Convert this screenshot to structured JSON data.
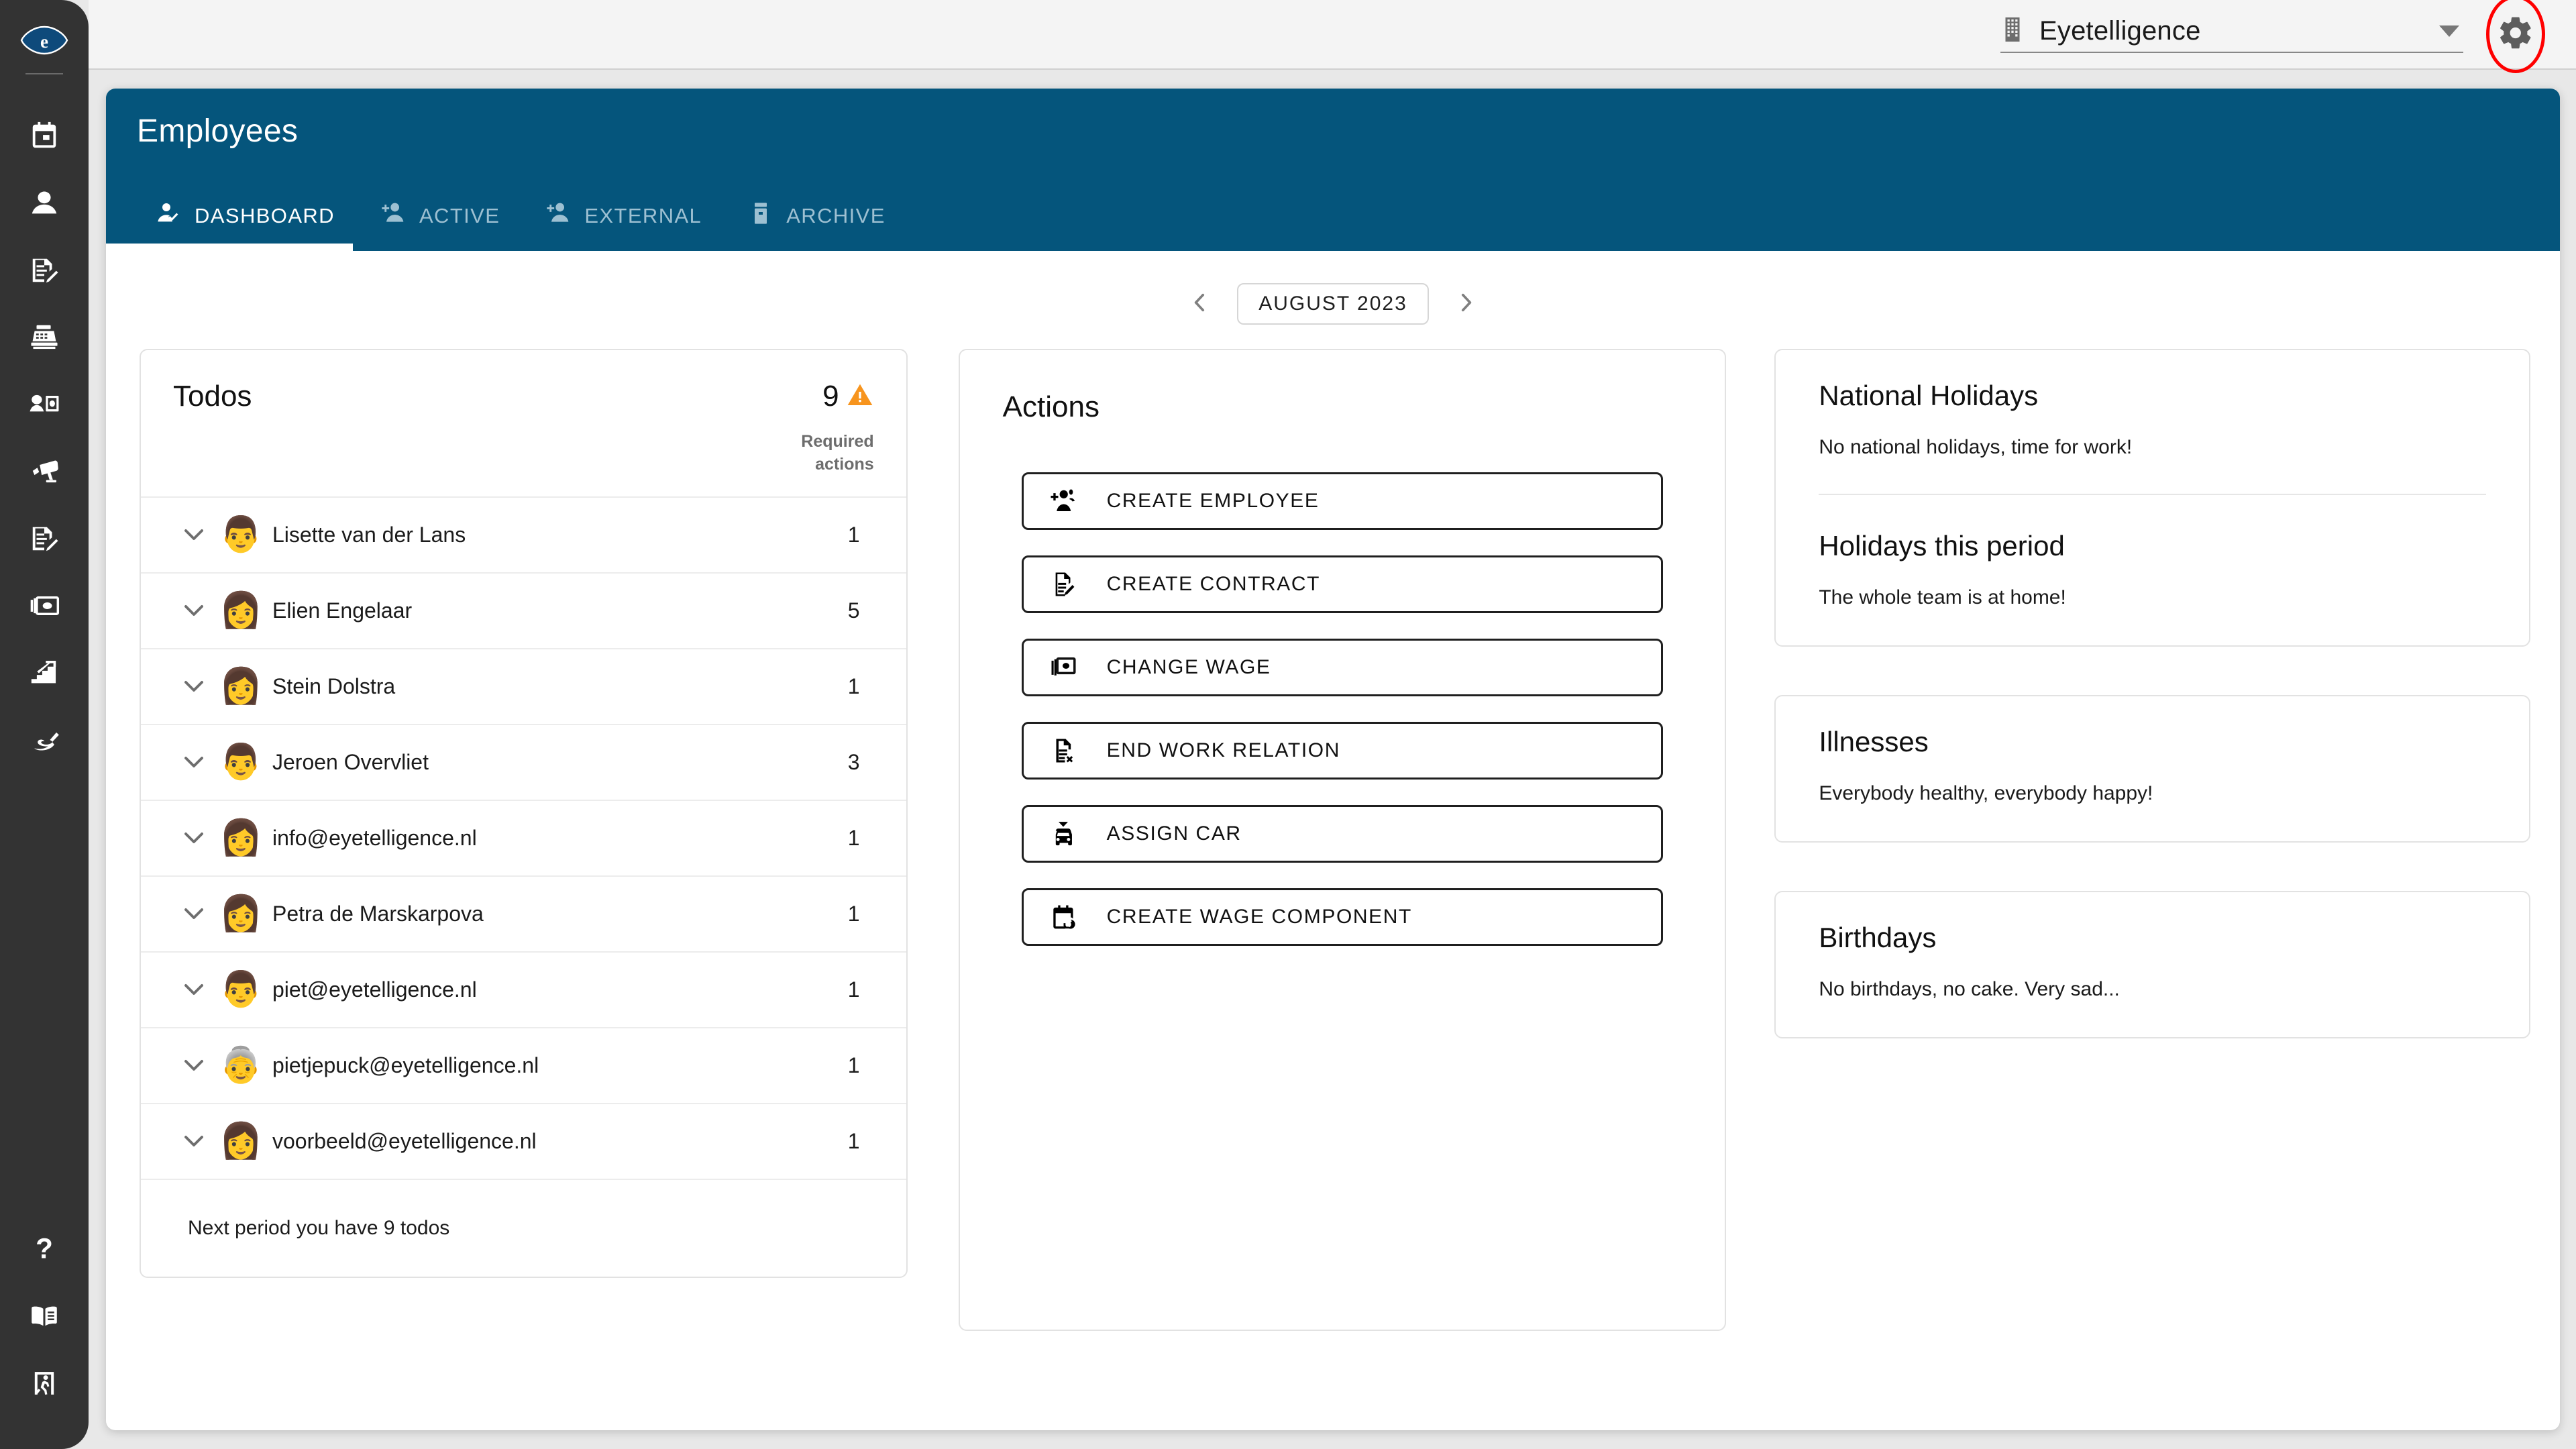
{
  "topbar": {
    "building_icon": "building-icon",
    "company_name": "Eyetelligence",
    "dropdown_icon": "chevron-down-icon",
    "settings_icon": "gear-icon"
  },
  "sidebar": {
    "logo": "eyetelligence-eye-logo",
    "items": [
      {
        "icon": "calendar-icon",
        "name": "sidebar-item-calendar"
      },
      {
        "icon": "person-icon",
        "name": "sidebar-item-employees"
      },
      {
        "icon": "document-edit-icon",
        "name": "sidebar-item-contracts"
      },
      {
        "icon": "cash-register-icon",
        "name": "sidebar-item-payroll"
      },
      {
        "icon": "person-id-card-icon",
        "name": "sidebar-item-personnel-file"
      },
      {
        "icon": "security-camera-icon",
        "name": "sidebar-item-monitoring"
      },
      {
        "icon": "document-edit-alt-icon",
        "name": "sidebar-item-declarations"
      },
      {
        "icon": "banknotes-icon",
        "name": "sidebar-item-wages"
      },
      {
        "icon": "stairs-arrow-up-icon",
        "name": "sidebar-item-growth"
      },
      {
        "icon": "signature-icon",
        "name": "sidebar-item-signing"
      }
    ],
    "bottom_items": [
      {
        "icon": "question-mark-icon",
        "name": "sidebar-item-help"
      },
      {
        "icon": "open-book-icon",
        "name": "sidebar-item-manual"
      },
      {
        "icon": "exit-door-icon",
        "name": "sidebar-item-logout"
      }
    ]
  },
  "page": {
    "title": "Employees",
    "tabs": [
      {
        "label": "DASHBOARD",
        "icon": "person-check-icon",
        "active": true
      },
      {
        "label": "ACTIVE",
        "icon": "person-add-icon",
        "active": false
      },
      {
        "label": "EXTERNAL",
        "icon": "person-add-icon",
        "active": false
      },
      {
        "label": "ARCHIVE",
        "icon": "archive-box-icon",
        "active": false
      }
    ]
  },
  "period": {
    "prev_icon": "chevron-left-icon",
    "label": "AUGUST 2023",
    "next_icon": "chevron-right-icon"
  },
  "todos": {
    "title": "Todos",
    "count": "9",
    "warning_icon": "warning-triangle-icon",
    "column_header_line1": "Required",
    "column_header_line2": "actions",
    "rows": [
      {
        "chevron": "chevron-down-icon",
        "avatar": "👨",
        "name": "Lisette van der Lans",
        "actions": "1"
      },
      {
        "chevron": "chevron-down-icon",
        "avatar": "👩",
        "name": "Elien Engelaar",
        "actions": "5"
      },
      {
        "chevron": "chevron-down-icon",
        "avatar": "👩",
        "name": "Stein Dolstra",
        "actions": "1"
      },
      {
        "chevron": "chevron-down-icon",
        "avatar": "👨",
        "name": "Jeroen Overvliet",
        "actions": "3"
      },
      {
        "chevron": "chevron-down-icon",
        "avatar": "👩",
        "name": "info@eyetelligence.nl",
        "actions": "1"
      },
      {
        "chevron": "chevron-down-icon",
        "avatar": "👩",
        "name": "Petra de Marskarpova",
        "actions": "1"
      },
      {
        "chevron": "chevron-down-icon",
        "avatar": "👨",
        "name": "piet@eyetelligence.nl",
        "actions": "1"
      },
      {
        "chevron": "chevron-down-icon",
        "avatar": "👵",
        "name": "pietjepuck@eyetelligence.nl",
        "actions": "1"
      },
      {
        "chevron": "chevron-down-icon",
        "avatar": "👩",
        "name": "voorbeeld@eyetelligence.nl",
        "actions": "1"
      }
    ],
    "footer": "Next period you have 9 todos"
  },
  "actions": {
    "title": "Actions",
    "buttons": [
      {
        "label": "CREATE EMPLOYEE",
        "icon": "person-add-group-icon"
      },
      {
        "label": "CREATE CONTRACT",
        "icon": "document-edit-icon"
      },
      {
        "label": "CHANGE WAGE",
        "icon": "banknotes-icon"
      },
      {
        "label": "END WORK RELATION",
        "icon": "document-x-icon"
      },
      {
        "label": "ASSIGN CAR",
        "icon": "car-icon"
      },
      {
        "label": "CREATE WAGE COMPONENT",
        "icon": "calendar-sync-icon"
      }
    ]
  },
  "side_cards": {
    "holidays": {
      "title": "National Holidays",
      "body": "No national holidays, time for work!",
      "sub_title": "Holidays this period",
      "sub_body": "The whole team is at home!"
    },
    "illnesses": {
      "title": "Illnesses",
      "body": "Everybody healthy, everybody happy!"
    },
    "birthdays": {
      "title": "Birthdays",
      "body": "No birthdays, no cake. Very sad..."
    }
  },
  "colors": {
    "header_blue": "#05557c",
    "sidebar_dark": "#333333",
    "warning_orange": "#f7941d",
    "highlight_red": "#ff0000",
    "tab_inactive": "#9dc0d2"
  }
}
